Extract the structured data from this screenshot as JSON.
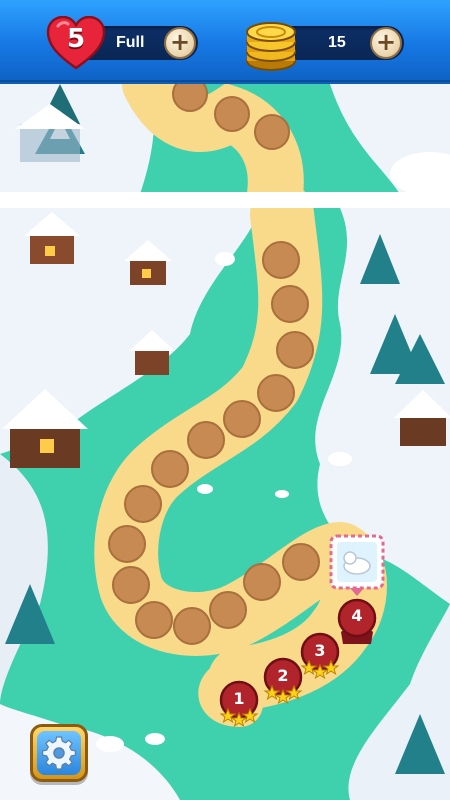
{
  "hud": {
    "lives": {
      "count": "5",
      "status": "Full",
      "plus_label": "+"
    },
    "coins": {
      "count": "15",
      "plus_label": "+"
    }
  },
  "map": {
    "levels": [
      {
        "number": "1",
        "stars": 3
      },
      {
        "number": "2",
        "stars": 3
      },
      {
        "number": "3",
        "stars": 3
      },
      {
        "number": "4",
        "stars": 0
      }
    ]
  },
  "colors": {
    "hud_blue": "#1778e4",
    "water": "#3fd0ae",
    "snow": "#f3f7fb",
    "path": "#f9d98a",
    "path_node": "#c68a52",
    "level_node": "#b2242b",
    "star": "#ffd21a"
  },
  "icons": {
    "lives": "heart-icon",
    "coins": "coin-stack-icon",
    "add": "plus-icon",
    "settings": "gear-icon",
    "next_level": "polar-bear-reward-icon"
  }
}
